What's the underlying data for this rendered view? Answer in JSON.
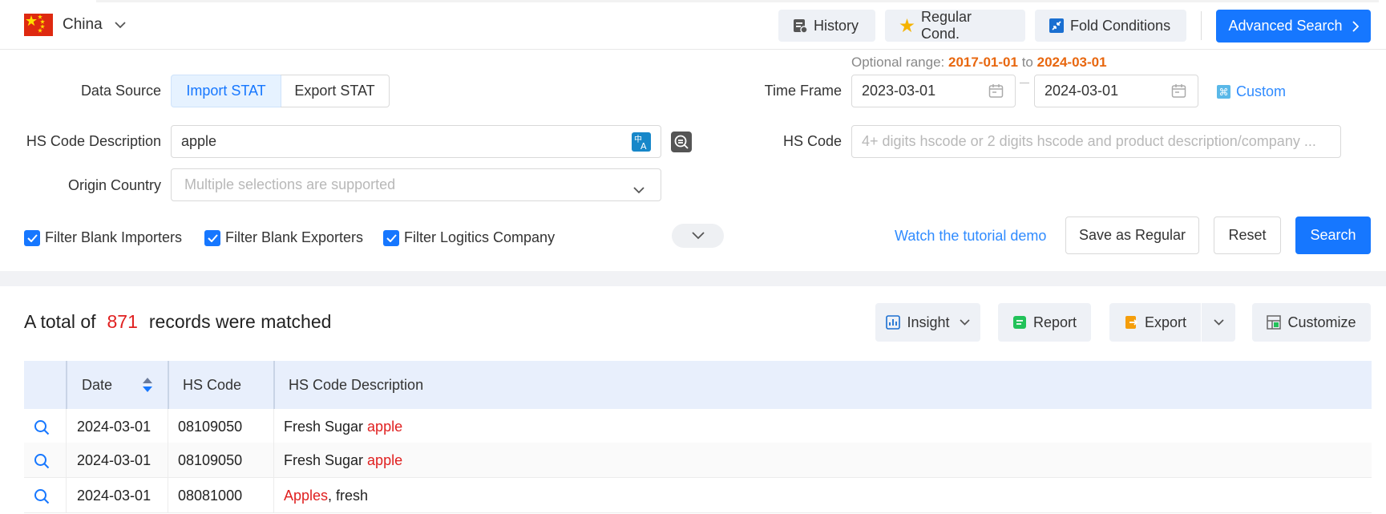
{
  "header": {
    "country": "China",
    "buttons": {
      "history": "History",
      "regular": "Regular Cond.",
      "fold": "Fold Conditions",
      "advanced": "Advanced Search"
    },
    "colors": {
      "primary": "#1677ff",
      "flag": "#de2910"
    }
  },
  "form": {
    "optional_range": {
      "label": "Optional range:",
      "from": "2017-01-01",
      "to_word": "to",
      "to": "2024-03-01"
    },
    "data_source": {
      "label": "Data Source",
      "options": [
        "Import STAT",
        "Export STAT"
      ],
      "selected": "Import STAT"
    },
    "time_frame": {
      "label": "Time Frame",
      "start": "2023-03-01",
      "end": "2024-03-01",
      "custom": "Custom"
    },
    "hs_desc": {
      "label": "HS Code Description",
      "value": "apple"
    },
    "hs_code": {
      "label": "HS Code",
      "placeholder": "4+ digits hscode or 2 digits hscode and product description/company ..."
    },
    "origin": {
      "label": "Origin Country",
      "placeholder": "Multiple selections are supported"
    },
    "filters": [
      "Filter Blank Importers",
      "Filter Blank Exporters",
      "Filter Logitics Company"
    ],
    "tutorial": "Watch the tutorial demo",
    "save_regular": "Save as Regular",
    "reset": "Reset",
    "search": "Search"
  },
  "results": {
    "prefix": "A total of",
    "count": "871",
    "suffix": "records were matched",
    "actions": {
      "insight": "Insight",
      "report": "Report",
      "export": "Export",
      "customize": "Customize"
    }
  },
  "table": {
    "columns": [
      "Date",
      "HS Code",
      "HS Code Description"
    ],
    "rows": [
      {
        "date": "2024-03-01",
        "code": "08109050",
        "desc_before": "Fresh Sugar ",
        "desc_hl": "apple",
        "desc_after": ""
      },
      {
        "date": "2024-03-01",
        "code": "08109050",
        "desc_before": "Fresh Sugar ",
        "desc_hl": "apple",
        "desc_after": ""
      },
      {
        "date": "2024-03-01",
        "code": "08081000",
        "desc_before": "",
        "desc_hl": "Apples",
        "desc_after": ", fresh"
      }
    ]
  }
}
